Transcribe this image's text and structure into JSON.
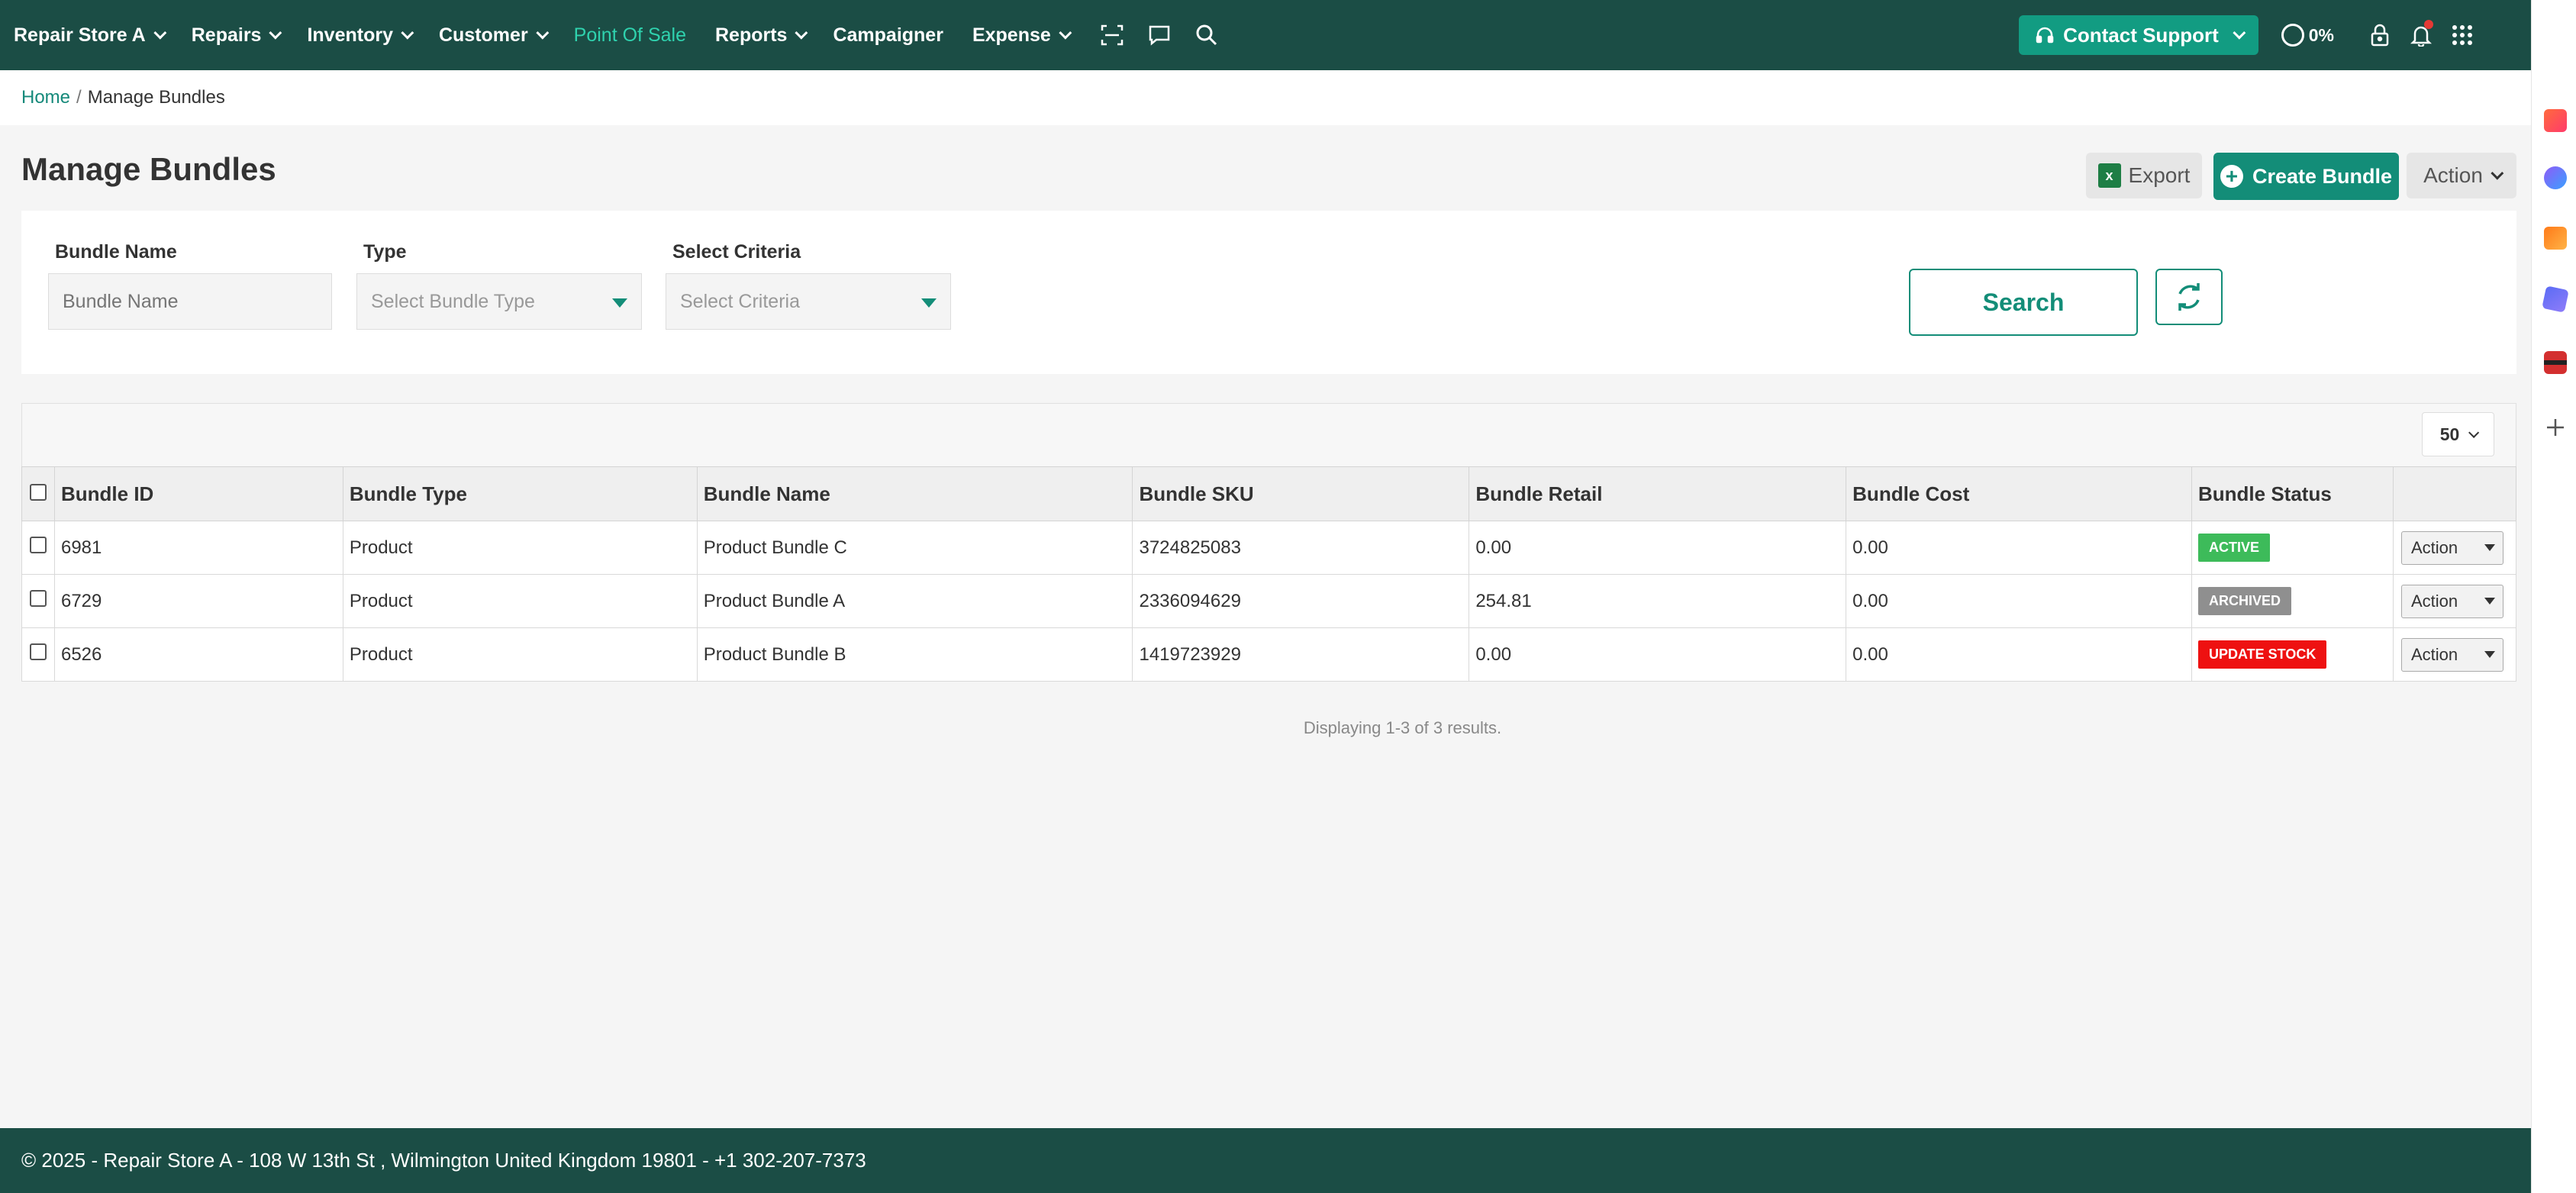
{
  "nav": {
    "items": [
      {
        "label": "Repair Store A",
        "dropdown": true
      },
      {
        "label": "Repairs",
        "dropdown": true
      },
      {
        "label": "Inventory",
        "dropdown": true
      },
      {
        "label": "Customer",
        "dropdown": true
      },
      {
        "label": "Point Of Sale",
        "dropdown": false,
        "active": true
      },
      {
        "label": "Reports",
        "dropdown": true
      },
      {
        "label": "Campaigner",
        "dropdown": false
      },
      {
        "label": "Expense",
        "dropdown": true
      }
    ],
    "icons": [
      "scan-icon",
      "chat-icon",
      "search-icon"
    ],
    "support_label": "Contact Support",
    "progress_text": "0%",
    "right_icons": [
      "lock-icon",
      "bell-icon",
      "apps-grid-icon"
    ]
  },
  "breadcrumb": {
    "home": "Home",
    "sep": "/",
    "current": "Manage Bundles"
  },
  "header": {
    "title": "Manage Bundles",
    "export_label": "Export",
    "create_label": "Create Bundle",
    "action_label": "Action"
  },
  "filters": {
    "bundle_name": {
      "label": "Bundle Name",
      "placeholder": "Bundle Name"
    },
    "type": {
      "label": "Type",
      "placeholder": "Select Bundle Type"
    },
    "criteria": {
      "label": "Select Criteria",
      "placeholder": "Select Criteria"
    },
    "search_label": "Search"
  },
  "table": {
    "page_size": "50",
    "columns": [
      "Bundle ID",
      "Bundle Type",
      "Bundle Name",
      "Bundle SKU",
      "Bundle Retail",
      "Bundle Cost",
      "Bundle Status"
    ],
    "rows": [
      {
        "id": "6981",
        "type": "Product",
        "name": "Product Bundle C",
        "sku": "3724825083",
        "retail": "0.00",
        "cost": "0.00",
        "status": "ACTIVE",
        "status_color": "#3dbb5a",
        "action": "Action"
      },
      {
        "id": "6729",
        "type": "Product",
        "name": "Product Bundle A",
        "sku": "2336094629",
        "retail": "254.81",
        "cost": "0.00",
        "status": "ARCHIVED",
        "status_color": "#8f8f8f",
        "action": "Action"
      },
      {
        "id": "6526",
        "type": "Product",
        "name": "Product Bundle B",
        "sku": "1419723929",
        "retail": "0.00",
        "cost": "0.00",
        "status": "UPDATE STOCK",
        "status_color": "#ee1111",
        "action": "Action"
      }
    ],
    "results_text": "Displaying 1-3 of 3 results."
  },
  "footer": {
    "text": "© 2025 - Repair Store A - 108 W 13th St , Wilmington United Kingdom 19801 - +1 302-207-7373"
  },
  "colors": {
    "brand": "#1b4d45",
    "accent": "#138d78",
    "nav_active": "#2fd2ae"
  }
}
